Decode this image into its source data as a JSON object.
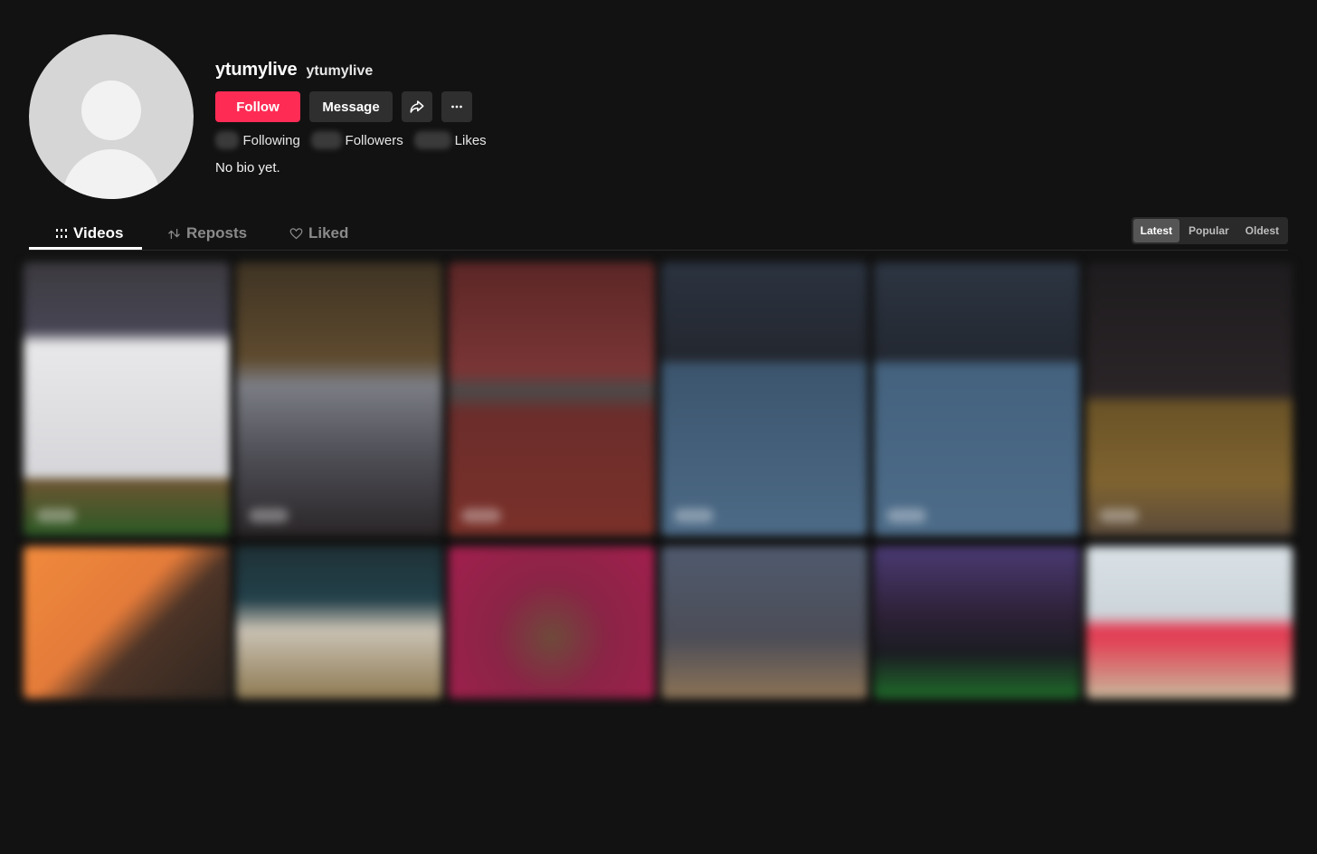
{
  "profile": {
    "username": "ytumylive",
    "nickname": "ytumylive",
    "follow_label": "Follow",
    "message_label": "Message",
    "stats": {
      "following_label": "Following",
      "followers_label": "Followers",
      "likes_label": "Likes"
    },
    "bio": "No bio yet."
  },
  "tabs": {
    "videos": "Videos",
    "reposts": "Reposts",
    "liked": "Liked"
  },
  "sort": {
    "latest": "Latest",
    "popular": "Popular",
    "oldest": "Oldest",
    "selected": "Latest"
  },
  "icons": {
    "share": "share-icon",
    "more": "more-icon",
    "videos_tab": "grid-icon",
    "reposts_tab": "repost-icon",
    "liked_tab": "heart-icon"
  },
  "colors": {
    "background": "#121212",
    "follow_button": "#fe2c55",
    "secondary_button": "#2f2f2f"
  }
}
